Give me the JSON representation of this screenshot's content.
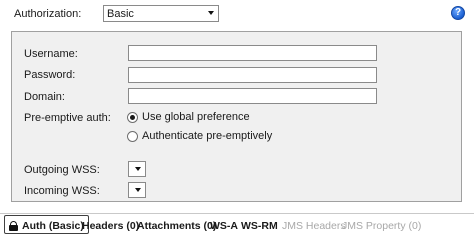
{
  "header": {
    "authorization_label": "Authorization:",
    "authorization_value": "Basic",
    "help_glyph": "?"
  },
  "form": {
    "username_label": "Username:",
    "username_value": "",
    "password_label": "Password:",
    "password_value": "",
    "domain_label": "Domain:",
    "domain_value": "",
    "preemptive_label": "Pre-emptive auth:",
    "preemptive_options": [
      {
        "label": "Use global preference",
        "checked": true
      },
      {
        "label": "Authenticate pre-emptively",
        "checked": false
      }
    ],
    "outgoing_wss_label": "Outgoing WSS:",
    "outgoing_wss_value": "",
    "incoming_wss_label": "Incoming WSS:",
    "incoming_wss_value": ""
  },
  "tabs": [
    {
      "label": "Auth (Basic)",
      "active": true,
      "enabled": true,
      "icon": "lock-icon"
    },
    {
      "label": "Headers (0)",
      "active": false,
      "enabled": true
    },
    {
      "label": "Attachments (0)",
      "active": false,
      "enabled": true
    },
    {
      "label": "WS-A",
      "active": false,
      "enabled": true
    },
    {
      "label": "WS-RM",
      "active": false,
      "enabled": true
    },
    {
      "label": "JMS Headers",
      "active": false,
      "enabled": false
    },
    {
      "label": "JMS Property (0)",
      "active": false,
      "enabled": false
    }
  ]
}
